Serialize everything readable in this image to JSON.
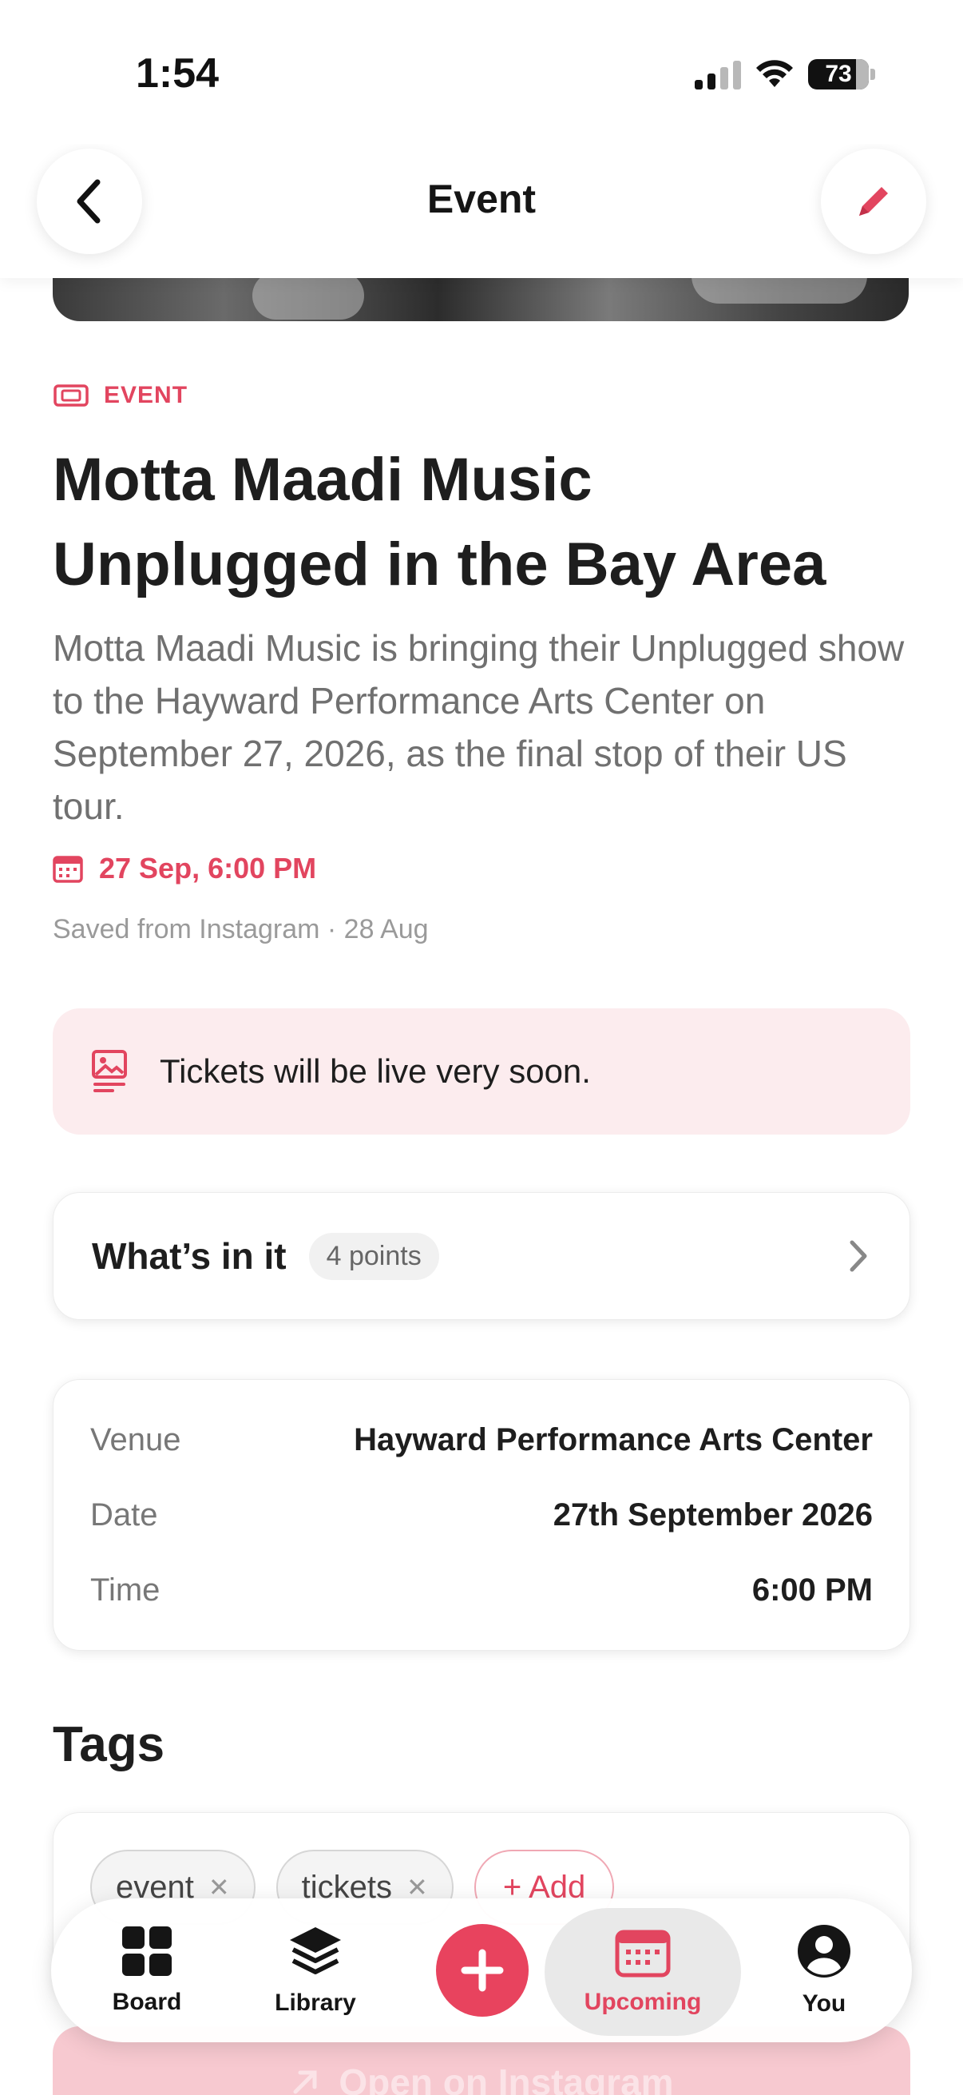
{
  "status_bar": {
    "time": "1:54",
    "battery": "73"
  },
  "header": {
    "title": "Event"
  },
  "event": {
    "type_label": "EVENT",
    "title": "Motta Maadi Music Unplugged in the Bay Area",
    "description": "Motta Maadi Music is bringing their Unplugged show to the Hayward Performance Arts Center on September 27, 2026, as the final stop of their US tour.",
    "datetime": "27 Sep, 6:00 PM",
    "source": "Saved from Instagram · 28 Aug"
  },
  "notice": {
    "text": "Tickets will be live very soon."
  },
  "whats_in_it": {
    "title": "What’s in it",
    "badge": "4 points"
  },
  "details": [
    {
      "key": "Venue",
      "value": "Hayward Performance Arts Center"
    },
    {
      "key": "Date",
      "value": "27th September 2026"
    },
    {
      "key": "Time",
      "value": "6:00 PM"
    }
  ],
  "tags": {
    "heading": "Tags",
    "items": [
      "event",
      "tickets"
    ],
    "add_label": "+ Add"
  },
  "open_button": {
    "label": "Open on Instagram"
  },
  "tabbar": {
    "board": "Board",
    "library": "Library",
    "upcoming": "Upcoming",
    "you": "You"
  },
  "colors": {
    "accent": "#e2455f",
    "notice_bg": "#fcecee"
  }
}
